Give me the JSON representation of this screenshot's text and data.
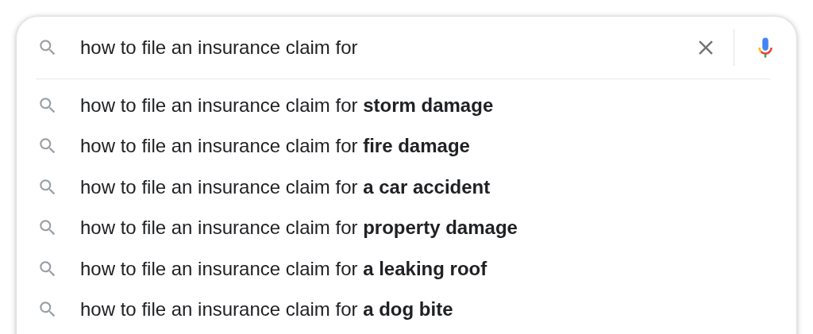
{
  "search": {
    "value": "how to file an insurance claim for"
  },
  "suggestions": [
    {
      "text": "how to file an insurance claim for **storm damage**"
    },
    {
      "text": "how to file an insurance claim for **fire damage**"
    },
    {
      "text": "how to file an insurance claim for **a car accident**"
    },
    {
      "text": "how to file an insurance claim for **property damage**"
    },
    {
      "text": "how to file an insurance claim for **a leaking roof**"
    },
    {
      "text": "how to file an insurance claim for **a dog bite**"
    }
  ]
}
